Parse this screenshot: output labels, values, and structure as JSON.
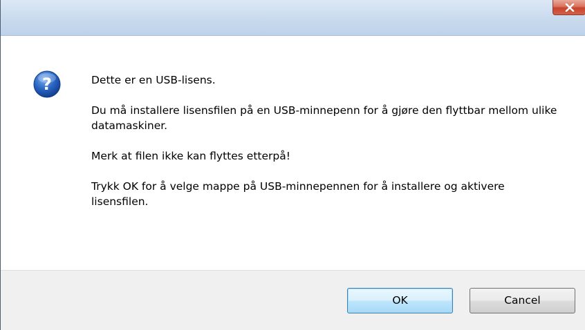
{
  "dialog": {
    "title": "",
    "icon": "question-icon",
    "message": [
      "Dette er en USB-lisens.",
      "Du må installere lisensfilen på en USB-minnepenn for å gjøre den flyttbar mellom ulike datamaskiner.",
      "Merk at filen ikke kan flyttes etterpå!",
      "Trykk OK for å velge mappe på USB-minnepennen for å installere og aktivere lisensfilen."
    ],
    "buttons": {
      "ok_label": "OK",
      "cancel_label": "Cancel"
    }
  },
  "colors": {
    "close_button": "#c7432b",
    "default_button_border": "#3c7fb1",
    "footer_background": "#f0f0f0",
    "question_icon": "#1e57b5"
  }
}
